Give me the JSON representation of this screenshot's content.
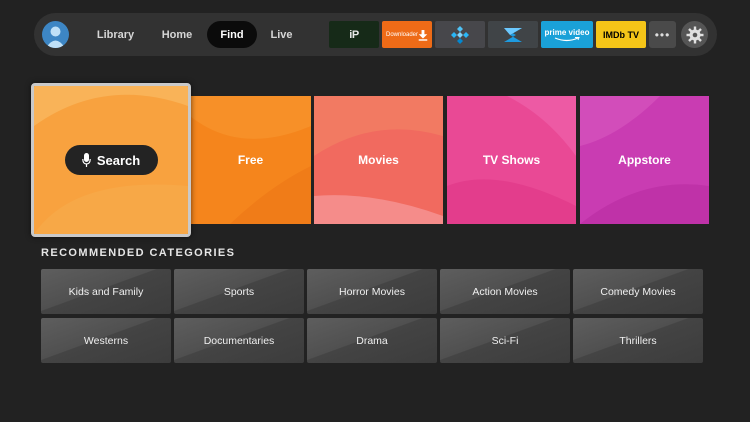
{
  "nav": {
    "tabs": [
      {
        "label": "Library"
      },
      {
        "label": "Home"
      },
      {
        "label": "Find"
      },
      {
        "label": "Live"
      }
    ],
    "active_tab": "Find",
    "apps": [
      {
        "name": "ip-app",
        "label": "iP"
      },
      {
        "name": "downloader-app",
        "label": "Downloader"
      },
      {
        "name": "kodi-app",
        "label": ""
      },
      {
        "name": "s-app",
        "label": ""
      },
      {
        "name": "prime-video-app",
        "label": "prime video"
      },
      {
        "name": "imdb-tv-app",
        "label": "IMDb TV"
      }
    ],
    "more_label": "•••"
  },
  "hero": {
    "search_label": "Search",
    "tiles": [
      {
        "label": "Free",
        "color": "#f58b24"
      },
      {
        "label": "Movies",
        "color": "#f26b63"
      },
      {
        "label": "TV Shows",
        "color": "#e84a9a"
      },
      {
        "label": "Appstore",
        "color": "#cb3fb0"
      }
    ]
  },
  "categories": {
    "title": "RECOMMENDED CATEGORIES",
    "items": [
      {
        "label": "Kids and Family"
      },
      {
        "label": "Sports"
      },
      {
        "label": "Horror Movies"
      },
      {
        "label": "Action Movies"
      },
      {
        "label": "Comedy Movies"
      },
      {
        "label": "Westerns"
      },
      {
        "label": "Documentaries"
      },
      {
        "label": "Drama"
      },
      {
        "label": "Sci-Fi"
      },
      {
        "label": "Thrillers"
      }
    ]
  },
  "colors": {
    "background": "#222222",
    "nav_bar": "#323232",
    "search_tile": "#f7a340",
    "downloader": "#ee6b17",
    "prime_video": "#1aa1d8",
    "imdb": "#f5c518"
  }
}
